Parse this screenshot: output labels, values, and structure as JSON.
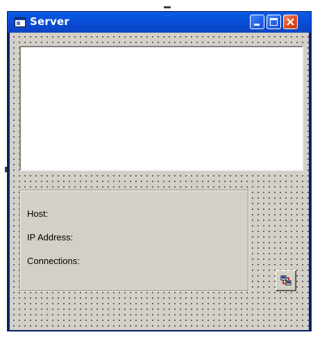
{
  "window": {
    "title": "Server",
    "icon": "form-icon",
    "controls": {
      "minimize": "minimize-icon",
      "maximize": "maximize-icon",
      "close": "close-icon"
    }
  },
  "form": {
    "textbox_value": "",
    "frame": {
      "labels": {
        "host": "Host:",
        "ip_address": "IP Address:",
        "connections": "Connections:"
      }
    },
    "winsock_control": {
      "icon": "winsock-control-icon"
    }
  },
  "colors": {
    "titlebar": "#0a4ed8",
    "form_background": "#d4d0c8",
    "close_button": "#dd4b23"
  }
}
